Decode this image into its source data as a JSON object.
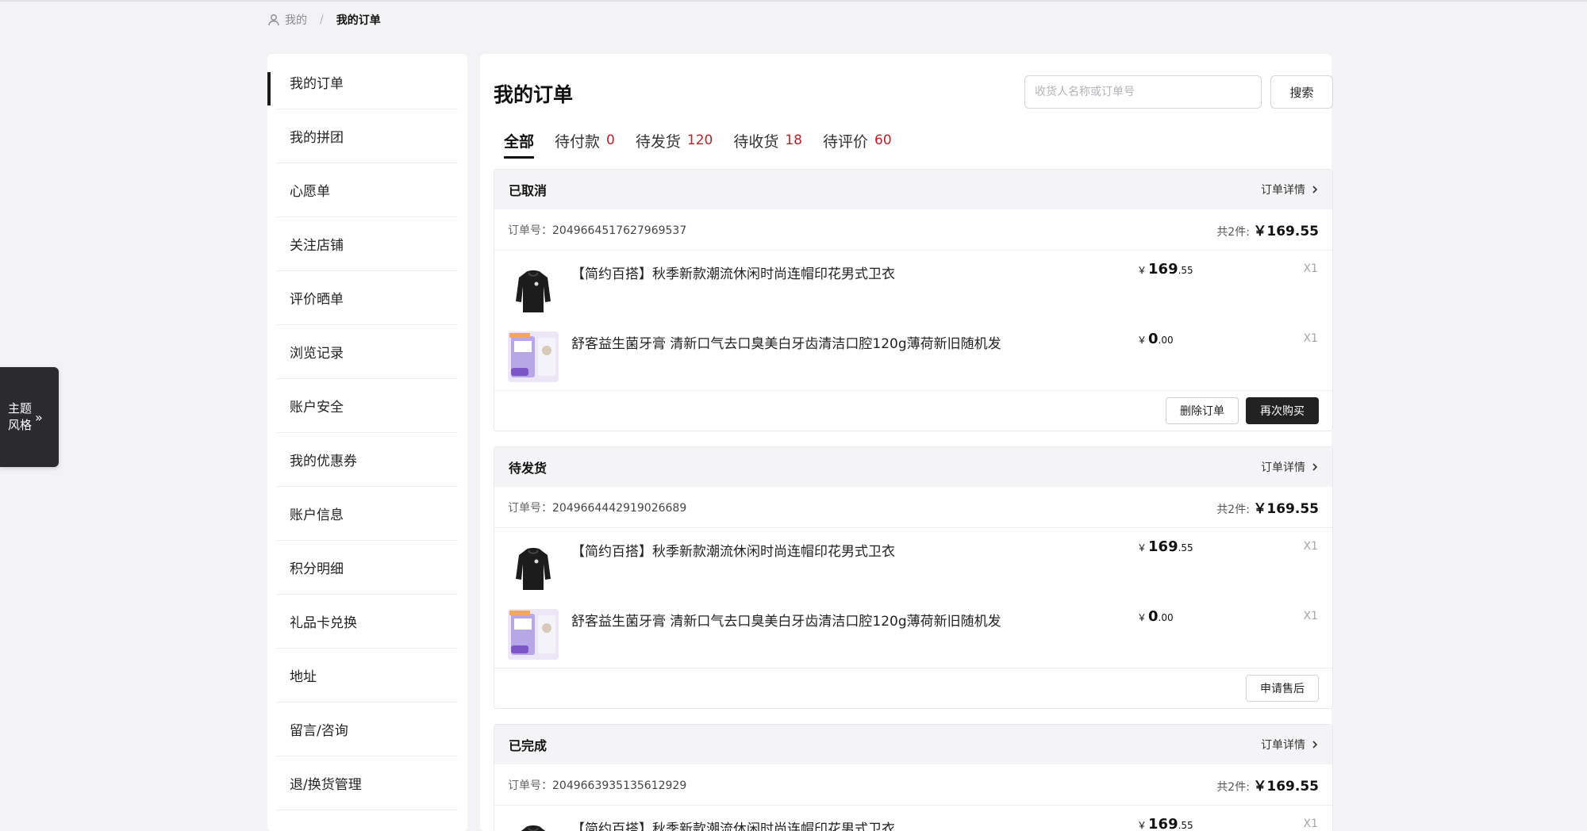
{
  "breadcrumb": {
    "home": "我的",
    "separator": "/",
    "current": "我的订单"
  },
  "theme_tab": {
    "line1": "主题",
    "line2": "风格",
    "arrow": "»"
  },
  "sidebar": {
    "items": [
      {
        "label": "我的订单",
        "active": true
      },
      {
        "label": "我的拼团"
      },
      {
        "label": "心愿单"
      },
      {
        "label": "关注店铺"
      },
      {
        "label": "评价晒单"
      },
      {
        "label": "浏览记录"
      },
      {
        "label": "账户安全"
      },
      {
        "label": "我的优惠券"
      },
      {
        "label": "账户信息"
      },
      {
        "label": "积分明细"
      },
      {
        "label": "礼品卡兑换"
      },
      {
        "label": "地址"
      },
      {
        "label": "留言/咨询"
      },
      {
        "label": "退/换货管理"
      }
    ]
  },
  "main": {
    "title": "我的订单",
    "search": {
      "placeholder": "收货人名称或订单号",
      "button": "搜索"
    },
    "tabs": [
      {
        "label": "全部",
        "count": "",
        "active": true
      },
      {
        "label": "待付款",
        "count": "0"
      },
      {
        "label": "待发货",
        "count": "120"
      },
      {
        "label": "待收货",
        "count": "18"
      },
      {
        "label": "待评价",
        "count": "60"
      }
    ],
    "order_labels": {
      "detail": "订单详情",
      "order_no_prefix": "订单号：",
      "sum_prefix": "共2件:"
    },
    "orders": [
      {
        "status": "已取消",
        "order_no": "2049664517627969537",
        "total": "￥169.55",
        "items": [
          {
            "name": "【简约百搭】秋季新款潮流休闲时尚连帽印花男式卫衣",
            "currency": "￥",
            "price_int": "169",
            "price_dec": ".55",
            "qty": "X1",
            "thumb": "hoodie"
          },
          {
            "name": "舒客益生菌牙膏 清新口气去口臭美白牙齿清洁口腔120g薄荷新旧随机发",
            "currency": "￥",
            "price_int": "0",
            "price_dec": ".00",
            "qty": "X1",
            "thumb": "toothpaste"
          }
        ],
        "actions": [
          {
            "label": "删除订单",
            "style": "outline"
          },
          {
            "label": "再次购买",
            "style": "dark"
          }
        ]
      },
      {
        "status": "待发货",
        "order_no": "2049664442919026689",
        "total": "￥169.55",
        "items": [
          {
            "name": "【简约百搭】秋季新款潮流休闲时尚连帽印花男式卫衣",
            "currency": "￥",
            "price_int": "169",
            "price_dec": ".55",
            "qty": "X1",
            "thumb": "hoodie"
          },
          {
            "name": "舒客益生菌牙膏 清新口气去口臭美白牙齿清洁口腔120g薄荷新旧随机发",
            "currency": "￥",
            "price_int": "0",
            "price_dec": ".00",
            "qty": "X1",
            "thumb": "toothpaste"
          }
        ],
        "actions": [
          {
            "label": "申请售后",
            "style": "outline"
          }
        ]
      },
      {
        "status": "已完成",
        "order_no": "2049663935135612929",
        "total": "￥169.55",
        "items": [
          {
            "name": "【简约百搭】秋季新款潮流休闲时尚连帽印花男式卫衣",
            "currency": "￥",
            "price_int": "169",
            "price_dec": ".55",
            "qty": "X1",
            "thumb": "hoodie"
          }
        ],
        "actions": []
      }
    ]
  },
  "colors": {
    "accent_count": "#b4242a",
    "dark_button": "#222222",
    "page_bg": "#f3f3f5"
  }
}
